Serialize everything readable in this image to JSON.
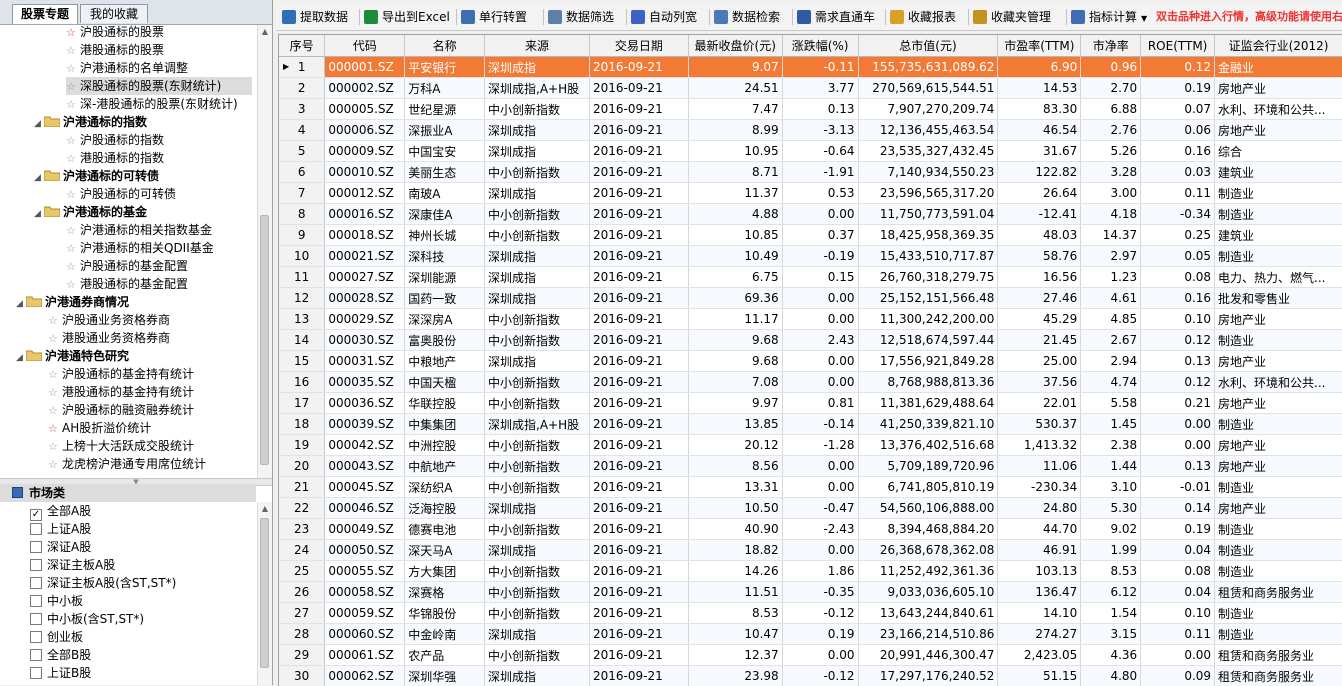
{
  "tabs": [
    "股票专题",
    "我的收藏"
  ],
  "tree": [
    {
      "label": "沪股通标的股票",
      "star": "red"
    },
    {
      "label": "港股通标的股票",
      "star": "gray"
    },
    {
      "label": "沪港通标的名单调整",
      "star": "gray"
    },
    {
      "label": "深股通标的股票(东财统计)",
      "star": "gray"
    },
    {
      "label": "深-港股通标的股票(东财统计)",
      "star": "gray"
    },
    {
      "label": "沪港通标的指数",
      "folder": true
    },
    {
      "label": "沪股通标的指数",
      "star": "gray"
    },
    {
      "label": "港股通标的指数",
      "star": "gray"
    },
    {
      "label": "沪港通标的可转债",
      "folder": true
    },
    {
      "label": "沪股通标的可转债",
      "star": "gray"
    },
    {
      "label": "沪港通标的基金",
      "folder": true
    },
    {
      "label": "沪港通标的相关指数基金",
      "star": "gray"
    },
    {
      "label": "沪港通标的相关QDII基金",
      "star": "gray"
    },
    {
      "label": "沪股通标的基金配置",
      "star": "gray"
    },
    {
      "label": "港股通标的基金配置",
      "star": "gray"
    },
    {
      "label": "沪港通券商情况",
      "folder": true
    },
    {
      "label": "沪股通业务资格券商",
      "star": "gray"
    },
    {
      "label": "港股通业务资格券商",
      "star": "gray"
    },
    {
      "label": "沪港通特色研究",
      "folder": true
    },
    {
      "label": "沪股通标的基金持有统计",
      "star": "gray"
    },
    {
      "label": "港股通标的基金持有统计",
      "star": "gray"
    },
    {
      "label": "沪股通标的融资融券统计",
      "star": "gray"
    },
    {
      "label": "AH股折溢价统计",
      "star": "red"
    },
    {
      "label": "上榜十大活跃成交股统计",
      "star": "gray"
    },
    {
      "label": "龙虎榜沪港通专用席位统计",
      "star": "gray"
    }
  ],
  "market": {
    "title": "市场类",
    "items": [
      {
        "label": "全部A股",
        "checked": true
      },
      {
        "label": "上证A股",
        "checked": false
      },
      {
        "label": "深证A股",
        "checked": false
      },
      {
        "label": "深证主板A股",
        "checked": false
      },
      {
        "label": "深证主板A股(含ST,ST*)",
        "checked": false
      },
      {
        "label": "中小板",
        "checked": false
      },
      {
        "label": "中小板(含ST,ST*)",
        "checked": false
      },
      {
        "label": "创业板",
        "checked": false
      },
      {
        "label": "全部B股",
        "checked": false
      },
      {
        "label": "上证B股",
        "checked": false
      }
    ]
  },
  "toolbar": {
    "buttons": [
      {
        "label": "提取数据",
        "icon": "extract-icon",
        "color": "#2f6fb8"
      },
      {
        "label": "导出到Excel",
        "icon": "excel-icon",
        "color": "#1e8a3c"
      },
      {
        "label": "单行转置",
        "icon": "transpose-icon",
        "color": "#3c6fb0"
      },
      {
        "label": "数据筛选",
        "icon": "filter-icon",
        "color": "#5d7fa8"
      },
      {
        "label": "自动列宽",
        "icon": "column-width-icon",
        "color": "#3d64c4"
      },
      {
        "label": "数据检索",
        "icon": "search-icon",
        "color": "#4a7aba"
      },
      {
        "label": "需求直通车",
        "icon": "request-icon",
        "color": "#2d5da0"
      },
      {
        "label": "收藏报表",
        "icon": "favorite-report-icon",
        "color": "#d8a227"
      },
      {
        "label": "收藏夹管理",
        "icon": "favorites-manage-icon",
        "color": "#c69320"
      },
      {
        "label": "指标计算",
        "icon": "indicator-calc-icon",
        "color": "#3f6db5"
      }
    ],
    "hint": "双击品种进入行情，高级功能请使用右"
  },
  "grid": {
    "columns": [
      "序号",
      "代码",
      "名称",
      "来源",
      "交易日期",
      "最新收盘价(元)",
      "涨跌幅(%)",
      "总市值(元)",
      "市盈率(TTM)",
      "市净率",
      "ROE(TTM)",
      "证监会行业(2012)"
    ],
    "rows": [
      [
        "1",
        "000001.SZ",
        "平安银行",
        "深圳成指",
        "2016-09-21",
        "9.07",
        "-0.11",
        "155,735,631,089.62",
        "6.90",
        "0.96",
        "0.12",
        "金融业"
      ],
      [
        "2",
        "000002.SZ",
        "万科A",
        "深圳成指,A+H股",
        "2016-09-21",
        "24.51",
        "3.77",
        "270,569,615,544.51",
        "14.53",
        "2.70",
        "0.19",
        "房地产业"
      ],
      [
        "3",
        "000005.SZ",
        "世纪星源",
        "中小创新指数",
        "2016-09-21",
        "7.47",
        "0.13",
        "7,907,270,209.74",
        "83.30",
        "6.88",
        "0.07",
        "水利、环境和公共..."
      ],
      [
        "4",
        "000006.SZ",
        "深振业A",
        "深圳成指",
        "2016-09-21",
        "8.99",
        "-3.13",
        "12,136,455,463.54",
        "46.54",
        "2.76",
        "0.06",
        "房地产业"
      ],
      [
        "5",
        "000009.SZ",
        "中国宝安",
        "深圳成指",
        "2016-09-21",
        "10.95",
        "-0.64",
        "23,535,327,432.45",
        "31.67",
        "5.26",
        "0.16",
        "综合"
      ],
      [
        "6",
        "000010.SZ",
        "美丽生态",
        "中小创新指数",
        "2016-09-21",
        "8.71",
        "-1.91",
        "7,140,934,550.23",
        "122.82",
        "3.28",
        "0.03",
        "建筑业"
      ],
      [
        "7",
        "000012.SZ",
        "南玻A",
        "深圳成指",
        "2016-09-21",
        "11.37",
        "0.53",
        "23,596,565,317.20",
        "26.64",
        "3.00",
        "0.11",
        "制造业"
      ],
      [
        "8",
        "000016.SZ",
        "深康佳A",
        "中小创新指数",
        "2016-09-21",
        "4.88",
        "0.00",
        "11,750,773,591.04",
        "-12.41",
        "4.18",
        "-0.34",
        "制造业"
      ],
      [
        "9",
        "000018.SZ",
        "神州长城",
        "中小创新指数",
        "2016-09-21",
        "10.85",
        "0.37",
        "18,425,958,369.35",
        "48.03",
        "14.37",
        "0.25",
        "建筑业"
      ],
      [
        "10",
        "000021.SZ",
        "深科技",
        "深圳成指",
        "2016-09-21",
        "10.49",
        "-0.19",
        "15,433,510,717.87",
        "58.76",
        "2.97",
        "0.05",
        "制造业"
      ],
      [
        "11",
        "000027.SZ",
        "深圳能源",
        "深圳成指",
        "2016-09-21",
        "6.75",
        "0.15",
        "26,760,318,279.75",
        "16.56",
        "1.23",
        "0.08",
        "电力、热力、燃气..."
      ],
      [
        "12",
        "000028.SZ",
        "国药一致",
        "深圳成指",
        "2016-09-21",
        "69.36",
        "0.00",
        "25,152,151,566.48",
        "27.46",
        "4.61",
        "0.16",
        "批发和零售业"
      ],
      [
        "13",
        "000029.SZ",
        "深深房A",
        "中小创新指数",
        "2016-09-21",
        "11.17",
        "0.00",
        "11,300,242,200.00",
        "45.29",
        "4.85",
        "0.10",
        "房地产业"
      ],
      [
        "14",
        "000030.SZ",
        "富奥股份",
        "中小创新指数",
        "2016-09-21",
        "9.68",
        "2.43",
        "12,518,674,597.44",
        "21.45",
        "2.67",
        "0.12",
        "制造业"
      ],
      [
        "15",
        "000031.SZ",
        "中粮地产",
        "深圳成指",
        "2016-09-21",
        "9.68",
        "0.00",
        "17,556,921,849.28",
        "25.00",
        "2.94",
        "0.13",
        "房地产业"
      ],
      [
        "16",
        "000035.SZ",
        "中国天楹",
        "中小创新指数",
        "2016-09-21",
        "7.08",
        "0.00",
        "8,768,988,813.36",
        "37.56",
        "4.74",
        "0.12",
        "水利、环境和公共..."
      ],
      [
        "17",
        "000036.SZ",
        "华联控股",
        "中小创新指数",
        "2016-09-21",
        "9.97",
        "0.81",
        "11,381,629,488.64",
        "22.01",
        "5.58",
        "0.21",
        "房地产业"
      ],
      [
        "18",
        "000039.SZ",
        "中集集团",
        "深圳成指,A+H股",
        "2016-09-21",
        "13.85",
        "-0.14",
        "41,250,339,821.10",
        "530.37",
        "1.45",
        "0.00",
        "制造业"
      ],
      [
        "19",
        "000042.SZ",
        "中洲控股",
        "中小创新指数",
        "2016-09-21",
        "20.12",
        "-1.28",
        "13,376,402,516.68",
        "1,413.32",
        "2.38",
        "0.00",
        "房地产业"
      ],
      [
        "20",
        "000043.SZ",
        "中航地产",
        "中小创新指数",
        "2016-09-21",
        "8.56",
        "0.00",
        "5,709,189,720.96",
        "11.06",
        "1.44",
        "0.13",
        "房地产业"
      ],
      [
        "21",
        "000045.SZ",
        "深纺织A",
        "中小创新指数",
        "2016-09-21",
        "13.31",
        "0.00",
        "6,741,805,810.19",
        "-230.34",
        "3.10",
        "-0.01",
        "制造业"
      ],
      [
        "22",
        "000046.SZ",
        "泛海控股",
        "深圳成指",
        "2016-09-21",
        "10.50",
        "-0.47",
        "54,560,106,888.00",
        "24.80",
        "5.30",
        "0.14",
        "房地产业"
      ],
      [
        "23",
        "000049.SZ",
        "德赛电池",
        "中小创新指数",
        "2016-09-21",
        "40.90",
        "-2.43",
        "8,394,468,884.20",
        "44.70",
        "9.02",
        "0.19",
        "制造业"
      ],
      [
        "24",
        "000050.SZ",
        "深天马A",
        "深圳成指",
        "2016-09-21",
        "18.82",
        "0.00",
        "26,368,678,362.08",
        "46.91",
        "1.99",
        "0.04",
        "制造业"
      ],
      [
        "25",
        "000055.SZ",
        "方大集团",
        "中小创新指数",
        "2016-09-21",
        "14.26",
        "1.86",
        "11,252,492,361.36",
        "103.13",
        "8.53",
        "0.08",
        "制造业"
      ],
      [
        "26",
        "000058.SZ",
        "深赛格",
        "中小创新指数",
        "2016-09-21",
        "11.51",
        "-0.35",
        "9,033,036,605.10",
        "136.47",
        "6.12",
        "0.04",
        "租赁和商务服务业"
      ],
      [
        "27",
        "000059.SZ",
        "华锦股份",
        "中小创新指数",
        "2016-09-21",
        "8.53",
        "-0.12",
        "13,643,244,840.61",
        "14.10",
        "1.54",
        "0.10",
        "制造业"
      ],
      [
        "28",
        "000060.SZ",
        "中金岭南",
        "深圳成指",
        "2016-09-21",
        "10.47",
        "0.19",
        "23,166,214,510.86",
        "274.27",
        "3.15",
        "0.11",
        "制造业"
      ],
      [
        "29",
        "000061.SZ",
        "农产品",
        "中小创新指数",
        "2016-09-21",
        "12.37",
        "0.00",
        "20,991,446,300.47",
        "2,423.05",
        "4.36",
        "0.00",
        "租赁和商务服务业"
      ],
      [
        "30",
        "000062.SZ",
        "深圳华强",
        "深圳成指",
        "2016-09-21",
        "23.98",
        "-0.12",
        "17,297,176,240.52",
        "51.15",
        "4.80",
        "0.09",
        "租赁和商务服务业"
      ]
    ],
    "selected_row": 0
  },
  "colors": {
    "selected": "#f27a35",
    "hint": "#e33333"
  }
}
